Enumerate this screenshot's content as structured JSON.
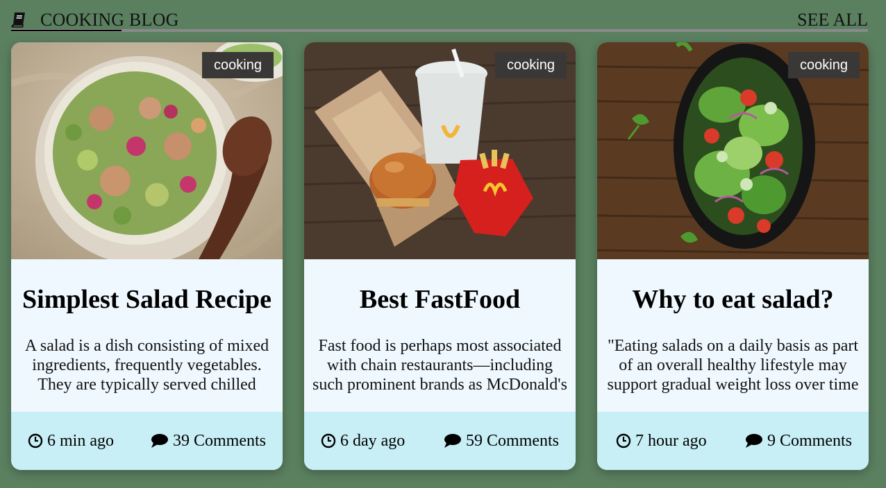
{
  "header": {
    "title": "COOKING BLOG",
    "book_icon": "book-icon",
    "see_all": "SEE ALL"
  },
  "posts": [
    {
      "tag": "cooking",
      "title": "Simplest Salad Recipe",
      "excerpt": "A salad is a dish consisting of mixed ingredients, frequently vegetables. They are typically served chilled",
      "time": "6 min ago",
      "comments": "39 Comments",
      "image": "salad-bowl-photo"
    },
    {
      "tag": "cooking",
      "title": "Best FastFood",
      "excerpt": "Fast food is perhaps most associated with chain restaurants—including such prominent brands as McDonald's",
      "time": "6 day ago",
      "comments": "59 Comments",
      "image": "fastfood-meal-photo"
    },
    {
      "tag": "cooking",
      "title": "Why to eat salad?",
      "excerpt": "\"Eating salads on a daily basis as part of an overall healthy lifestyle may support gradual weight loss over time",
      "time": "7 hour ago",
      "comments": "9 Comments",
      "image": "green-salad-photo"
    }
  ],
  "colors": {
    "background": "#5b8060",
    "card_body": "#eff8fe",
    "card_footer": "#c8eef6",
    "tag_bg": "#3a3836"
  }
}
